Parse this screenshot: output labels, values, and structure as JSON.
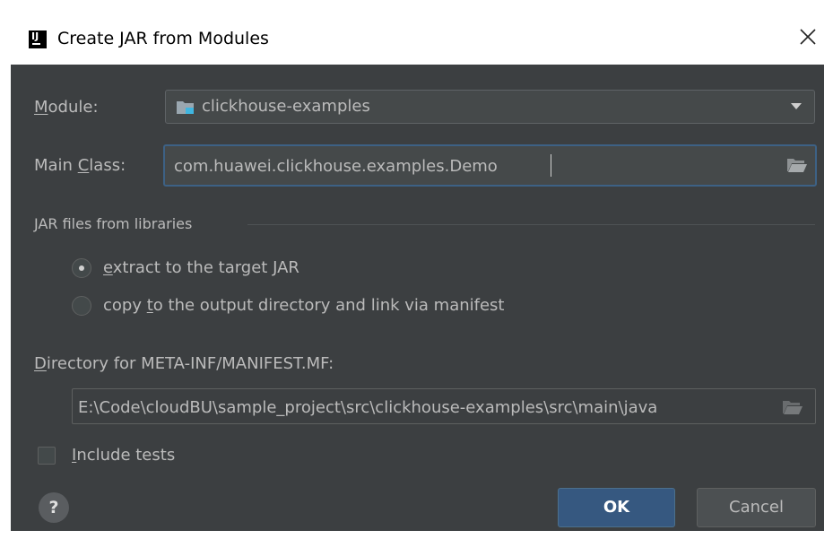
{
  "window": {
    "title": "Create JAR from Modules",
    "app_icon": "intellij-idea-icon",
    "close_icon": "close-icon"
  },
  "module": {
    "label_mnemonic": "M",
    "label_rest": "odule:",
    "value": "clickhouse-examples",
    "icon": "module-folder-icon"
  },
  "main_class": {
    "label_pre": "Main ",
    "label_mnemonic": "C",
    "label_rest": "lass:",
    "value": "com.huawei.clickhouse.examples.Demo"
  },
  "libraries": {
    "section_title": "JAR files from libraries",
    "options": [
      {
        "pre": "",
        "mnemonic": "e",
        "rest": "xtract to the target JAR",
        "checked": true
      },
      {
        "pre": "copy ",
        "mnemonic": "t",
        "rest": "o the output directory and link via manifest",
        "checked": false
      }
    ]
  },
  "manifest_dir": {
    "label_mnemonic": "D",
    "label_rest": "irectory for META-INF/MANIFEST.MF:",
    "value": "E:\\Code\\cloudBU\\sample_project\\src\\clickhouse-examples\\src\\main\\java"
  },
  "include_tests": {
    "label_mnemonic": "I",
    "label_rest": "nclude tests",
    "checked": false
  },
  "buttons": {
    "help": "?",
    "ok": "OK",
    "cancel": "Cancel"
  },
  "colors": {
    "background": "#3c3f41",
    "field_background": "#45494a",
    "focus_border": "#3d6185",
    "primary_button": "#365880",
    "text": "#bbbbbb"
  }
}
